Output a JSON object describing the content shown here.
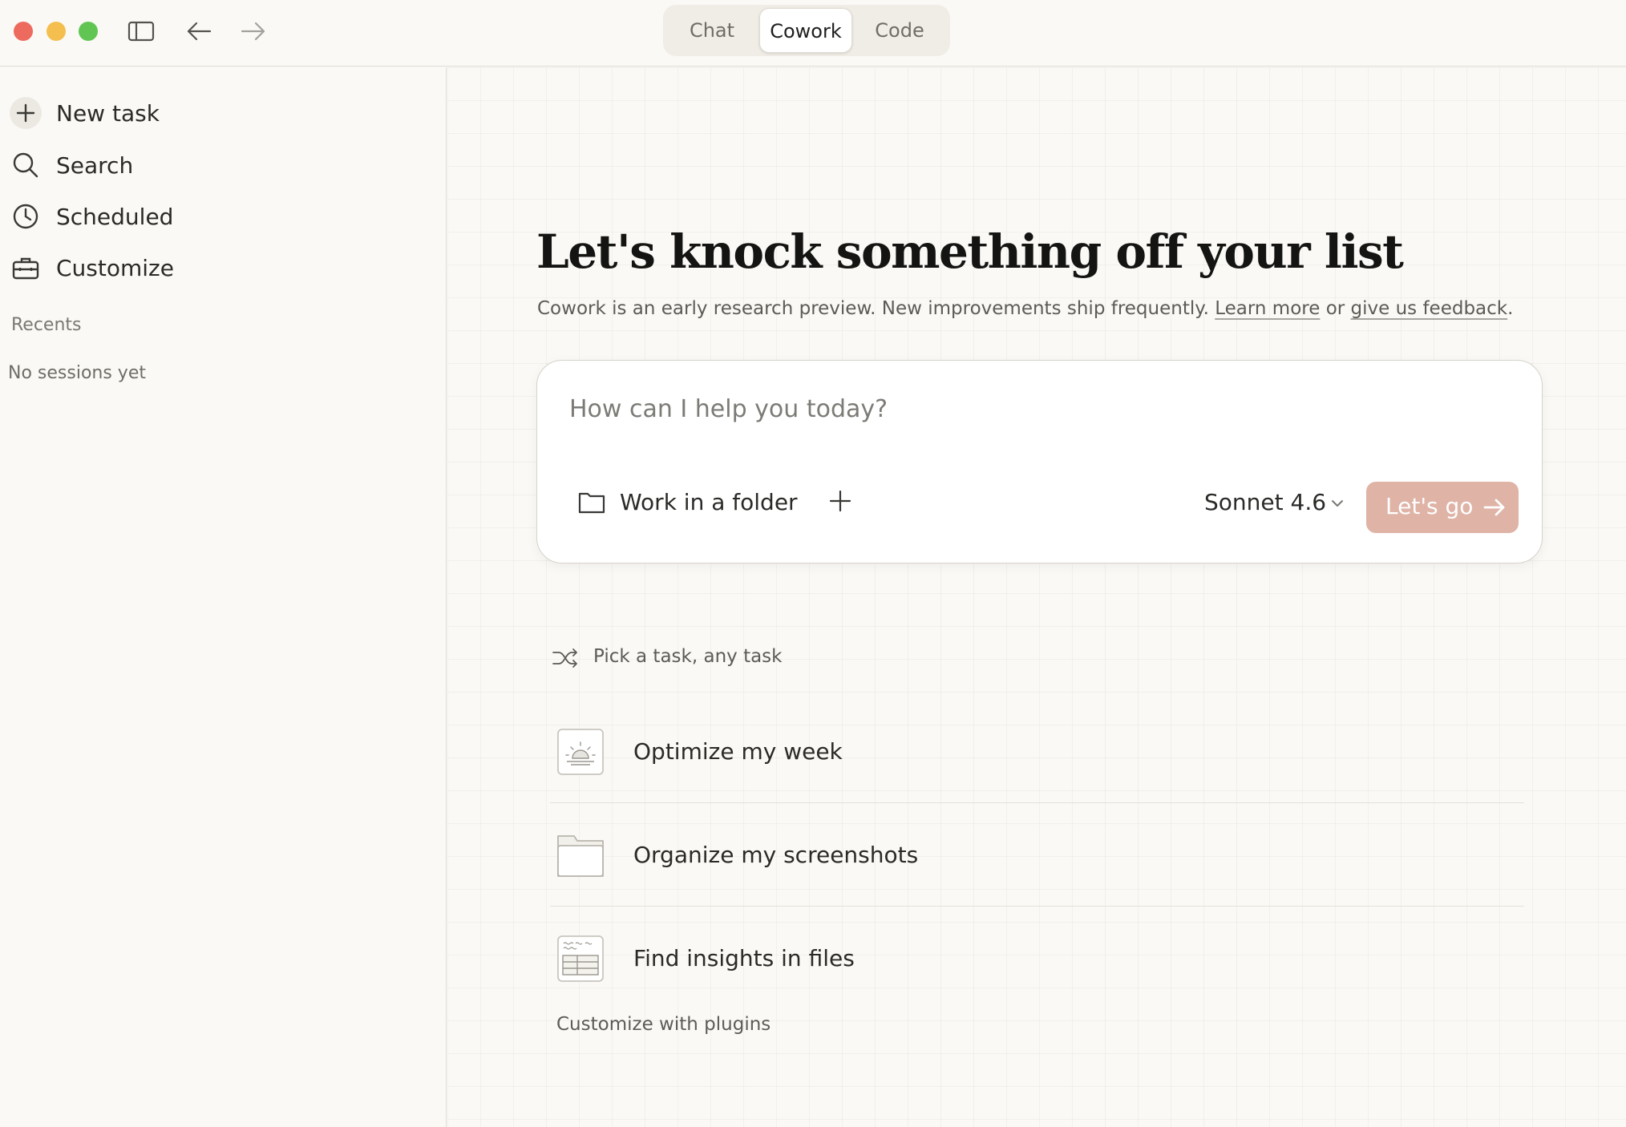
{
  "window": {
    "mode_tabs": [
      {
        "label": "Chat",
        "active": false
      },
      {
        "label": "Cowork",
        "active": true
      },
      {
        "label": "Code",
        "active": false
      }
    ]
  },
  "sidebar": {
    "items": [
      {
        "label": "New task",
        "icon": "plus-icon"
      },
      {
        "label": "Search",
        "icon": "search-icon"
      },
      {
        "label": "Scheduled",
        "icon": "clock-icon"
      },
      {
        "label": "Customize",
        "icon": "toolbox-icon"
      }
    ],
    "recents_label": "Recents",
    "recents_empty": "No sessions yet"
  },
  "main": {
    "headline": "Let's knock something off your list",
    "subline_text": "Cowork is an early research preview. New improvements ship frequently.",
    "learn_more": "Learn more",
    "or": "or",
    "feedback": "give us feedback",
    "period": ".",
    "composer": {
      "placeholder": "How can I help you today?",
      "value": "",
      "folder_label": "Work in a folder",
      "model_label": "Sonnet 4.6",
      "submit_label": "Let's go"
    },
    "pick_label": "Pick a task, any task",
    "tasks": [
      {
        "label": "Optimize my week",
        "icon": "sunrise-icon"
      },
      {
        "label": "Organize my screenshots",
        "icon": "folder-icon"
      },
      {
        "label": "Find insights in files",
        "icon": "spreadsheet-icon"
      }
    ],
    "plugins_label": "Customize with plugins"
  },
  "colors": {
    "background": "#faf9f5",
    "accent_button": "#dfb3a6",
    "border": "#e0ddd5"
  }
}
